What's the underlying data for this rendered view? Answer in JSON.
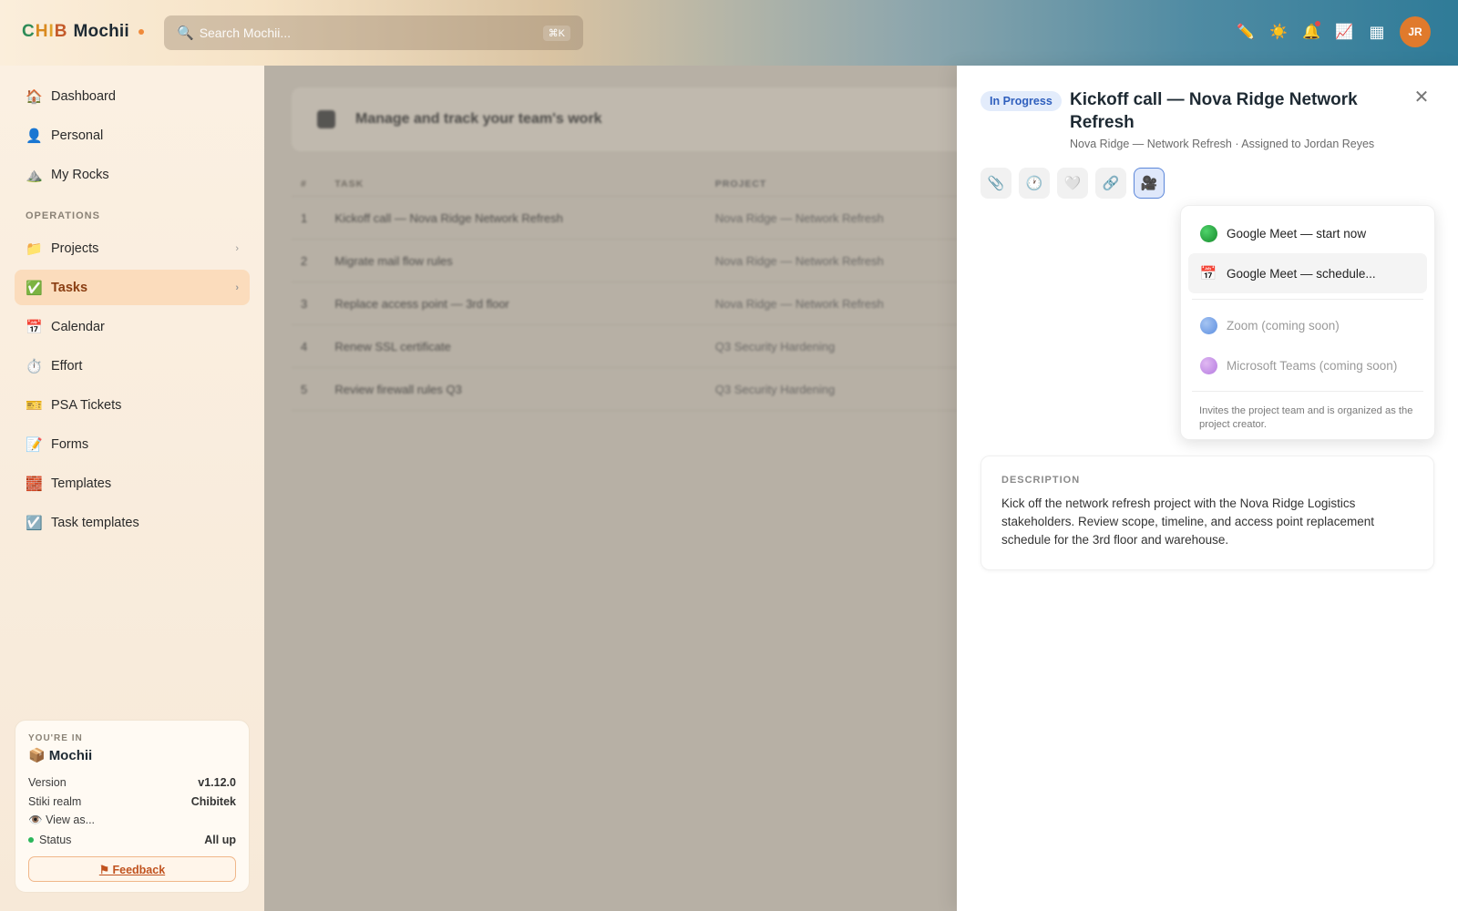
{
  "app": {
    "logo_prefix": [
      "C",
      "H",
      "I",
      "B"
    ],
    "logo_name": "Mochii"
  },
  "search": {
    "icon": "search-icon",
    "placeholder": "Search Mochii...",
    "shortcut": "⌘K"
  },
  "topbar": {
    "icons": [
      {
        "name": "pencil-icon",
        "glyph": "✏️"
      },
      {
        "name": "sun-icon",
        "glyph": "☀️"
      },
      {
        "name": "bell-icon",
        "glyph": "🔔"
      },
      {
        "name": "chart-icon",
        "glyph": "📈"
      },
      {
        "name": "grid-icon",
        "glyph": "▦"
      }
    ],
    "avatar_initials": "JR"
  },
  "sidebar": {
    "items_top": [
      {
        "label": "Dashboard",
        "icon": "🏠"
      },
      {
        "label": "Personal",
        "icon": "👤"
      },
      {
        "label": "My Rocks",
        "icon": "⛰️"
      }
    ],
    "section_label": "OPERATIONS",
    "items_ops": [
      {
        "label": "Projects",
        "icon": "📁",
        "chevron": "›"
      },
      {
        "label": "Tasks",
        "icon": "✅",
        "chevron": "›",
        "active": true
      },
      {
        "label": "Calendar",
        "icon": "📅"
      },
      {
        "label": "Effort",
        "icon": "⏱️"
      },
      {
        "label": "PSA Tickets",
        "icon": "🎫"
      },
      {
        "label": "Forms",
        "icon": "📝"
      },
      {
        "label": "Templates",
        "icon": "🧱"
      },
      {
        "label": "Task templates",
        "icon": "☑️"
      }
    ],
    "env": {
      "label": "YOU'RE IN",
      "icon": "📦",
      "name": "Mochii",
      "version_label": "Version",
      "version": "v1.12.0",
      "realm_label": "Stiki realm",
      "realm": "Chibitek",
      "view_as": "View as...",
      "status_label": "Status",
      "status": "All up",
      "feedback": "⚑ Feedback"
    }
  },
  "main": {
    "title": "Manage and track your team's work",
    "columns": [
      "#",
      "TASK",
      "PROJECT"
    ],
    "rows": [
      {
        "num": "1",
        "task": "Kickoff call — Nova Ridge Network Refresh",
        "project": "Nova Ridge — Network Refresh"
      },
      {
        "num": "2",
        "task": "Migrate mail flow rules",
        "project": "Nova Ridge — Network Refresh"
      },
      {
        "num": "3",
        "task": "Replace access point — 3rd floor",
        "project": "Nova Ridge — Network Refresh"
      },
      {
        "num": "4",
        "task": "Renew SSL certificate",
        "project": "Q3 Security Hardening"
      },
      {
        "num": "5",
        "task": "Review firewall rules Q3",
        "project": "Q3 Security Hardening"
      }
    ]
  },
  "drawer": {
    "status_badge": "In Progress",
    "title": "Kickoff call — Nova Ridge Network Refresh",
    "subtitle": "Nova Ridge — Network Refresh · Assigned to Jordan Reyes",
    "close": "✕",
    "actions": [
      {
        "name": "attachment-icon",
        "glyph": "📎"
      },
      {
        "name": "clock-icon",
        "glyph": "🕐"
      },
      {
        "name": "heart-icon",
        "glyph": "🤍"
      },
      {
        "name": "link-icon",
        "glyph": "🔗"
      },
      {
        "name": "video-camera-icon",
        "glyph": "🎥"
      }
    ],
    "meeting_menu": {
      "items": [
        {
          "label": "Google Meet — start now",
          "color": "#1fa83a"
        },
        {
          "label": "Google Meet — schedule...",
          "icon": "📅"
        },
        {
          "label": "Zoom (coming soon)",
          "color": "#6f9ee8"
        },
        {
          "label": "Microsoft Teams (coming soon)",
          "color": "#c58ee6"
        }
      ],
      "note": "Invites the project team and is organized as the project creator."
    },
    "description": {
      "label": "DESCRIPTION",
      "text": "Kick off the network refresh project with the Nova Ridge Logistics stakeholders. Review scope, timeline, and access point replacement schedule for the 3rd floor and warehouse."
    }
  }
}
